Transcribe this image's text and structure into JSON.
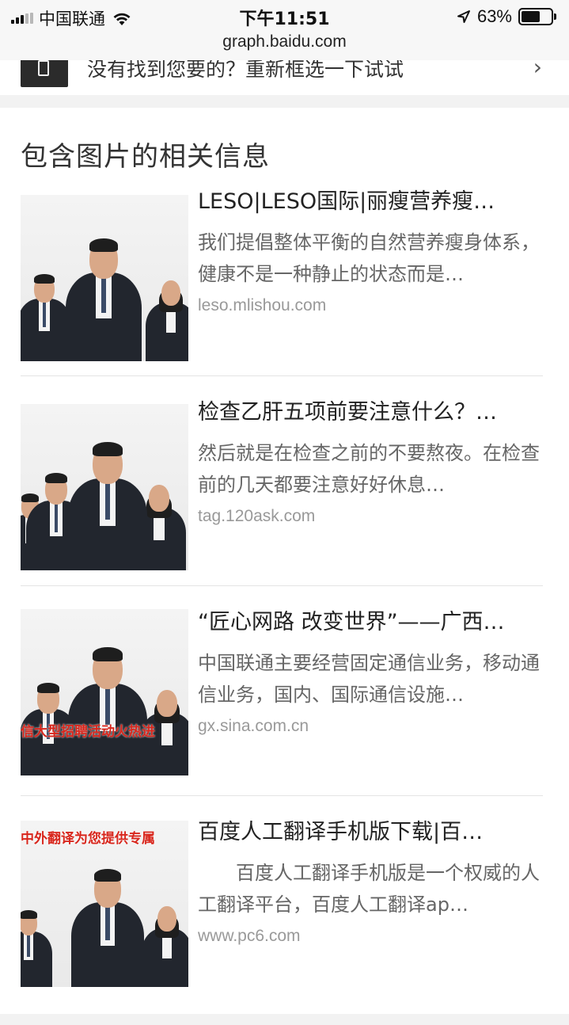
{
  "status_bar": {
    "carrier": "中国联通",
    "time": "下午11:51",
    "battery_percent": "63%",
    "battery_level": 0.63,
    "signal_bars_filled": 3,
    "signal_bars_total": 5
  },
  "url_bar": {
    "url": "graph.baidu.com"
  },
  "feedback": {
    "text": "没有找到您要的？重新框选一下试试",
    "icon": "crop-image-icon",
    "arrow": "›"
  },
  "section": {
    "title": "包含图片的相关信息"
  },
  "results": [
    {
      "title": "LESO|LESO国际|丽瘦营养瘦…",
      "description": "我们提倡整体平衡的自然营养瘦身体系，健康不是一种静止的状态而是…",
      "url": "leso.mlishou.com"
    },
    {
      "title": "检查乙肝五项前要注意什么？…",
      "description": "然后就是在检查之前的不要熬夜。在检查前的几天都要注意好好休息…",
      "url": "tag.120ask.com"
    },
    {
      "title": "“匠心网路 改变世界”——广西…",
      "description": "中国联通主要经营固定通信业务，移动通信业务，国内、国际通信设施…",
      "url": "gx.sina.com.cn",
      "image_banner": "信大型招聘活动火热进"
    },
    {
      "title": "百度人工翻译手机版下载|百…",
      "description": "　　百度人工翻译手机版是一个权威的人工翻译平台，百度人工翻译ap…",
      "url": "www.pc6.com",
      "image_banner": "中外翻译为您提供专属"
    }
  ],
  "colors": {
    "background": "#f2f2f2",
    "card": "#ffffff",
    "title_text": "#222222",
    "desc_text": "#666666",
    "url_text": "#999999",
    "banner_red": "#d8261c"
  }
}
